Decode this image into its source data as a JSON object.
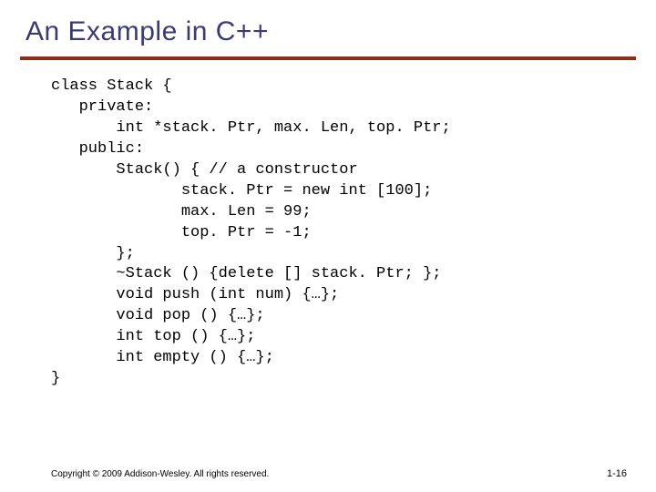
{
  "title": "An Example in C++",
  "code_lines": [
    "class Stack {",
    "   private:",
    "       int *stack. Ptr, max. Len, top. Ptr;",
    "   public:",
    "       Stack() { // a constructor",
    "              stack. Ptr = new int [100];",
    "              max. Len = 99;",
    "              top. Ptr = -1;",
    "       };",
    "       ~Stack () {delete [] stack. Ptr; };",
    "       void push (int num) {…};",
    "       void pop () {…};",
    "       int top () {…};",
    "       int empty () {…};",
    "}"
  ],
  "footer": {
    "copyright": "Copyright © 2009 Addison-Wesley. All rights reserved.",
    "page": "1-16"
  }
}
